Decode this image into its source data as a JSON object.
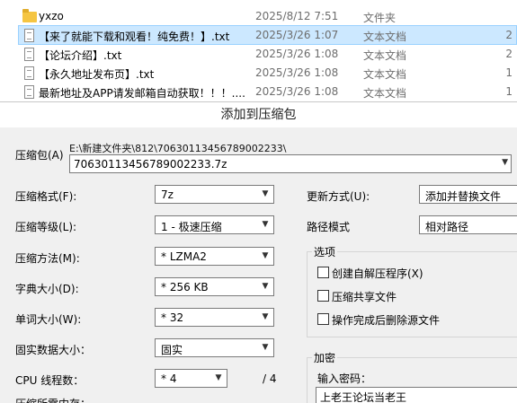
{
  "files": [
    {
      "name": "yxzo",
      "date": "2025/8/12 7:51",
      "type": "文件夹",
      "size": "",
      "kind": "folder",
      "selected": false
    },
    {
      "name": "【来了就能下载和观看！纯免费！】.txt",
      "date": "2025/3/26 1:07",
      "type": "文本文档",
      "size": "2",
      "kind": "txt",
      "selected": true
    },
    {
      "name": "【论坛介绍】.txt",
      "date": "2025/3/26 1:08",
      "type": "文本文档",
      "size": "2",
      "kind": "txt",
      "selected": false
    },
    {
      "name": "【永久地址发布页】.txt",
      "date": "2025/3/26 1:08",
      "type": "文本文档",
      "size": "1",
      "kind": "txt",
      "selected": false
    },
    {
      "name": "最新地址及APP请发邮箱自动获取！！！....",
      "date": "2025/3/26 1:08",
      "type": "文本文档",
      "size": "1",
      "kind": "txt",
      "selected": false
    }
  ],
  "dialog": {
    "title": "添加到压缩包",
    "archive_label": "压缩包(A)",
    "archive_dir": "E:\\新建文件夹\\812\\70630113456789002233\\",
    "archive_name": "70630113456789002233.7z",
    "left": {
      "format_label": "压缩格式(F):",
      "format_value": "7z",
      "level_label": "压缩等级(L):",
      "level_value": "1 - 极速压缩",
      "method_label": "压缩方法(M):",
      "method_value": "* LZMA2",
      "dict_label": "字典大小(D):",
      "dict_value": "* 256 KB",
      "word_label": "单词大小(W):",
      "word_value": "* 32",
      "solid_label": "固实数据大小：",
      "solid_value": "固实",
      "cpu_label": "CPU 线程数：",
      "cpu_value": "* 4",
      "cpu_total": "/ 4",
      "memory_label": "压缩所需内存："
    },
    "right": {
      "update_label": "更新方式(U):",
      "update_value": "添加并替换文件",
      "pathmode_label": "路径模式",
      "pathmode_value": "相对路径",
      "options_title": "选项",
      "options": [
        {
          "label": "创建自解压程序(X)",
          "checked": false
        },
        {
          "label": "压缩共享文件",
          "checked": false
        },
        {
          "label": "操作完成后删除源文件",
          "checked": false
        }
      ],
      "encryption_title": "加密",
      "password_label": "输入密码：",
      "password_value": "上老王论坛当老王"
    }
  },
  "colors": {
    "selection_bg": "#cce8ff",
    "selection_border": "#99d1ff",
    "dialog_bg": "#f0f0f0",
    "folder": "#f5c542",
    "meta_text": "#6d6d6d"
  }
}
